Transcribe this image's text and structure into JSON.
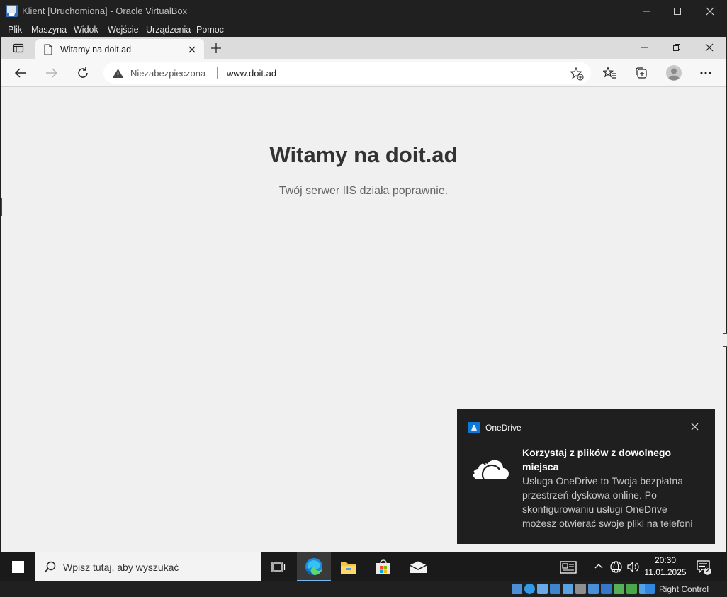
{
  "vbox": {
    "title": "Klient [Uruchomiona] - Oracle VirtualBox",
    "menu": [
      "Plik",
      "Maszyna",
      "Widok",
      "Wejście",
      "Urządzenia",
      "Pomoc"
    ],
    "host_key": "Right Control"
  },
  "browser": {
    "tab_title": "Witamy na doit.ad",
    "security_label": "Niezabezpieczona",
    "url": "www.doit.ad"
  },
  "page": {
    "heading": "Witamy na doit.ad",
    "subtitle": "Twój serwer IIS działa poprawnie."
  },
  "toast": {
    "app": "OneDrive",
    "headline": "Korzystaj z plików z dowolnego miejsca",
    "body_lines": [
      "Usługa OneDrive to Twoja bezpłatna",
      "przestrzeń dyskowa online. Po",
      "skonfigurowaniu usługi OneDrive",
      "możesz otwierać swoje pliki na telefoni"
    ]
  },
  "taskbar": {
    "search_placeholder": "Wpisz tutaj, aby wyszukać",
    "time": "20:30",
    "date": "11.01.2025",
    "notification_count": "2"
  },
  "colors": {
    "accent_edge": "#0f6cbd",
    "toast_bg": "#1f1f1f",
    "page_bg": "#f0f0f0"
  }
}
